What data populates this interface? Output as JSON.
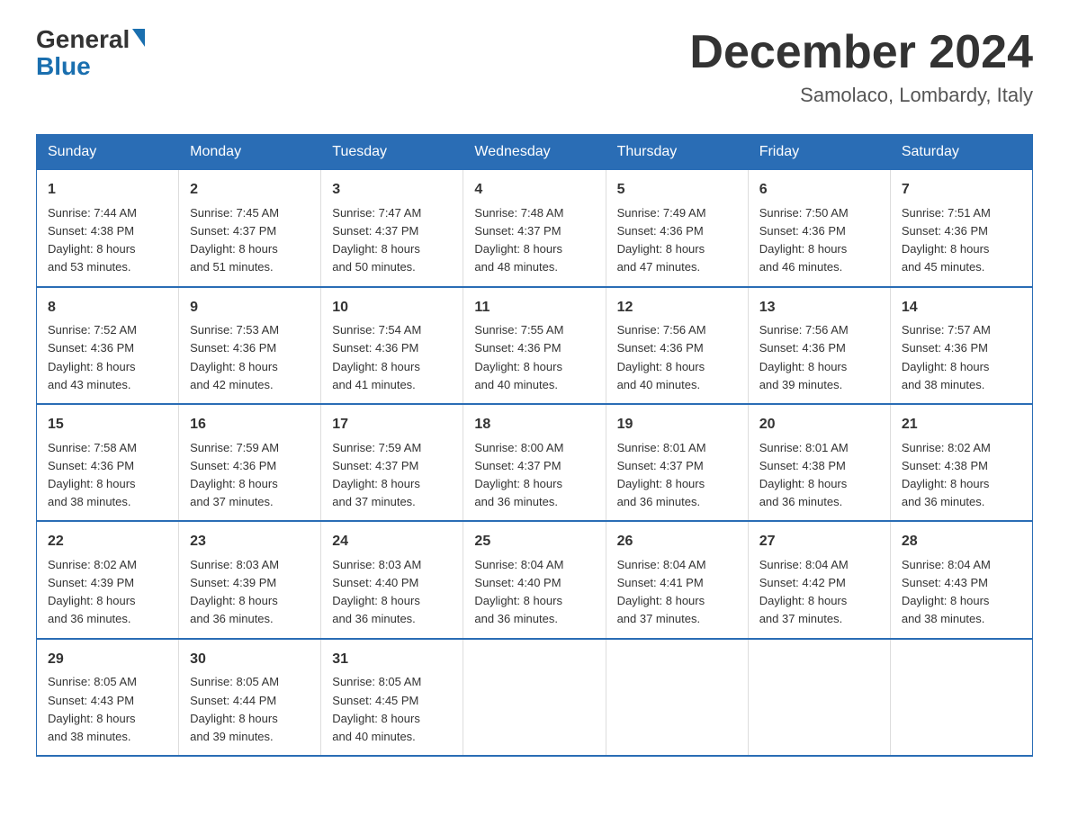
{
  "logo": {
    "line1": "General",
    "triangle": "▶",
    "line2": "Blue"
  },
  "title": {
    "month_year": "December 2024",
    "location": "Samolaco, Lombardy, Italy"
  },
  "days_of_week": [
    "Sunday",
    "Monday",
    "Tuesday",
    "Wednesday",
    "Thursday",
    "Friday",
    "Saturday"
  ],
  "weeks": [
    [
      {
        "day": "1",
        "info": "Sunrise: 7:44 AM\nSunset: 4:38 PM\nDaylight: 8 hours\nand 53 minutes."
      },
      {
        "day": "2",
        "info": "Sunrise: 7:45 AM\nSunset: 4:37 PM\nDaylight: 8 hours\nand 51 minutes."
      },
      {
        "day": "3",
        "info": "Sunrise: 7:47 AM\nSunset: 4:37 PM\nDaylight: 8 hours\nand 50 minutes."
      },
      {
        "day": "4",
        "info": "Sunrise: 7:48 AM\nSunset: 4:37 PM\nDaylight: 8 hours\nand 48 minutes."
      },
      {
        "day": "5",
        "info": "Sunrise: 7:49 AM\nSunset: 4:36 PM\nDaylight: 8 hours\nand 47 minutes."
      },
      {
        "day": "6",
        "info": "Sunrise: 7:50 AM\nSunset: 4:36 PM\nDaylight: 8 hours\nand 46 minutes."
      },
      {
        "day": "7",
        "info": "Sunrise: 7:51 AM\nSunset: 4:36 PM\nDaylight: 8 hours\nand 45 minutes."
      }
    ],
    [
      {
        "day": "8",
        "info": "Sunrise: 7:52 AM\nSunset: 4:36 PM\nDaylight: 8 hours\nand 43 minutes."
      },
      {
        "day": "9",
        "info": "Sunrise: 7:53 AM\nSunset: 4:36 PM\nDaylight: 8 hours\nand 42 minutes."
      },
      {
        "day": "10",
        "info": "Sunrise: 7:54 AM\nSunset: 4:36 PM\nDaylight: 8 hours\nand 41 minutes."
      },
      {
        "day": "11",
        "info": "Sunrise: 7:55 AM\nSunset: 4:36 PM\nDaylight: 8 hours\nand 40 minutes."
      },
      {
        "day": "12",
        "info": "Sunrise: 7:56 AM\nSunset: 4:36 PM\nDaylight: 8 hours\nand 40 minutes."
      },
      {
        "day": "13",
        "info": "Sunrise: 7:56 AM\nSunset: 4:36 PM\nDaylight: 8 hours\nand 39 minutes."
      },
      {
        "day": "14",
        "info": "Sunrise: 7:57 AM\nSunset: 4:36 PM\nDaylight: 8 hours\nand 38 minutes."
      }
    ],
    [
      {
        "day": "15",
        "info": "Sunrise: 7:58 AM\nSunset: 4:36 PM\nDaylight: 8 hours\nand 38 minutes."
      },
      {
        "day": "16",
        "info": "Sunrise: 7:59 AM\nSunset: 4:36 PM\nDaylight: 8 hours\nand 37 minutes."
      },
      {
        "day": "17",
        "info": "Sunrise: 7:59 AM\nSunset: 4:37 PM\nDaylight: 8 hours\nand 37 minutes."
      },
      {
        "day": "18",
        "info": "Sunrise: 8:00 AM\nSunset: 4:37 PM\nDaylight: 8 hours\nand 36 minutes."
      },
      {
        "day": "19",
        "info": "Sunrise: 8:01 AM\nSunset: 4:37 PM\nDaylight: 8 hours\nand 36 minutes."
      },
      {
        "day": "20",
        "info": "Sunrise: 8:01 AM\nSunset: 4:38 PM\nDaylight: 8 hours\nand 36 minutes."
      },
      {
        "day": "21",
        "info": "Sunrise: 8:02 AM\nSunset: 4:38 PM\nDaylight: 8 hours\nand 36 minutes."
      }
    ],
    [
      {
        "day": "22",
        "info": "Sunrise: 8:02 AM\nSunset: 4:39 PM\nDaylight: 8 hours\nand 36 minutes."
      },
      {
        "day": "23",
        "info": "Sunrise: 8:03 AM\nSunset: 4:39 PM\nDaylight: 8 hours\nand 36 minutes."
      },
      {
        "day": "24",
        "info": "Sunrise: 8:03 AM\nSunset: 4:40 PM\nDaylight: 8 hours\nand 36 minutes."
      },
      {
        "day": "25",
        "info": "Sunrise: 8:04 AM\nSunset: 4:40 PM\nDaylight: 8 hours\nand 36 minutes."
      },
      {
        "day": "26",
        "info": "Sunrise: 8:04 AM\nSunset: 4:41 PM\nDaylight: 8 hours\nand 37 minutes."
      },
      {
        "day": "27",
        "info": "Sunrise: 8:04 AM\nSunset: 4:42 PM\nDaylight: 8 hours\nand 37 minutes."
      },
      {
        "day": "28",
        "info": "Sunrise: 8:04 AM\nSunset: 4:43 PM\nDaylight: 8 hours\nand 38 minutes."
      }
    ],
    [
      {
        "day": "29",
        "info": "Sunrise: 8:05 AM\nSunset: 4:43 PM\nDaylight: 8 hours\nand 38 minutes."
      },
      {
        "day": "30",
        "info": "Sunrise: 8:05 AM\nSunset: 4:44 PM\nDaylight: 8 hours\nand 39 minutes."
      },
      {
        "day": "31",
        "info": "Sunrise: 8:05 AM\nSunset: 4:45 PM\nDaylight: 8 hours\nand 40 minutes."
      },
      {
        "day": "",
        "info": ""
      },
      {
        "day": "",
        "info": ""
      },
      {
        "day": "",
        "info": ""
      },
      {
        "day": "",
        "info": ""
      }
    ]
  ]
}
